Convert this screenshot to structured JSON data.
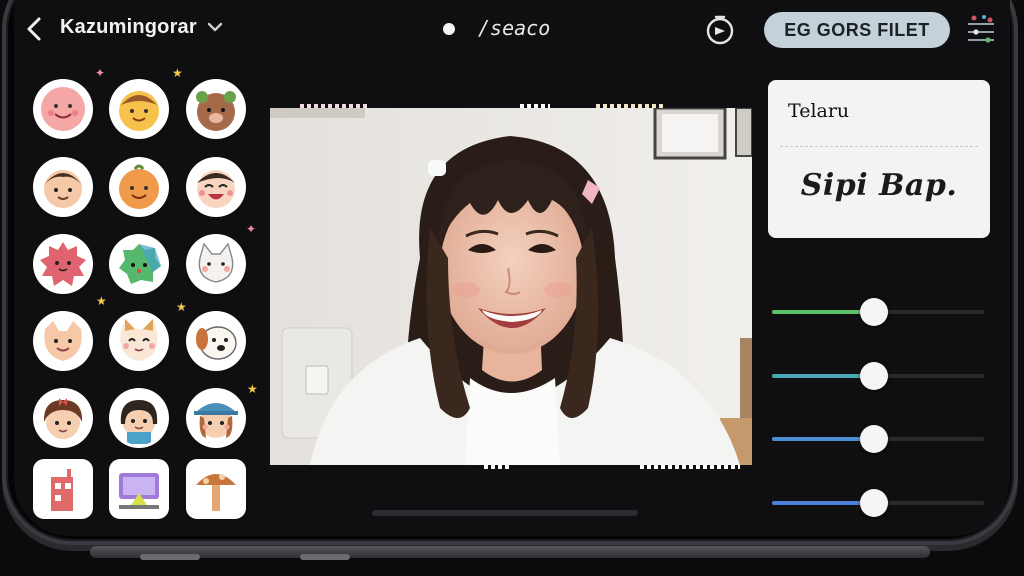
{
  "header": {
    "account_name": "Kazumingorar",
    "center_text": "/seaco",
    "action_pill": "EG GORS FILET"
  },
  "icons": {
    "back": "chevron-left-icon",
    "dropdown": "chevron-down-icon",
    "record": "record-dot-icon",
    "timer": "timer-icon",
    "menu": "sliders-menu-icon"
  },
  "stickers": [
    {
      "label": "pink-face"
    },
    {
      "label": "orange-monkey"
    },
    {
      "label": "brown-bear"
    },
    {
      "label": "boy-face"
    },
    {
      "label": "orange-face"
    },
    {
      "label": "laughing-face"
    },
    {
      "label": "pink-blob"
    },
    {
      "label": "green-blob"
    },
    {
      "label": "white-cat"
    },
    {
      "label": "fox-face"
    },
    {
      "label": "cat-face"
    },
    {
      "label": "dog-face"
    },
    {
      "label": "girl-ribbon"
    },
    {
      "label": "girl-bob"
    },
    {
      "label": "girl-hat"
    },
    {
      "label": "pink-building"
    },
    {
      "label": "purple-screen"
    },
    {
      "label": "mushroom"
    }
  ],
  "text_card": {
    "title": "Telaru",
    "script": "Sipi Bap."
  },
  "sliders": [
    {
      "name": "slider-1",
      "value": 0.48,
      "color": "#5fc16b"
    },
    {
      "name": "slider-2",
      "value": 0.48,
      "color": "#4aa6b4"
    },
    {
      "name": "slider-3",
      "value": 0.48,
      "color": "#4e8fd3"
    },
    {
      "name": "slider-4",
      "value": 0.48,
      "color": "#4e7fd6"
    }
  ],
  "colors": {
    "pill_bg": "#c5d1d8",
    "card_bg": "#f3f3f3",
    "background": "#0f0f11"
  }
}
